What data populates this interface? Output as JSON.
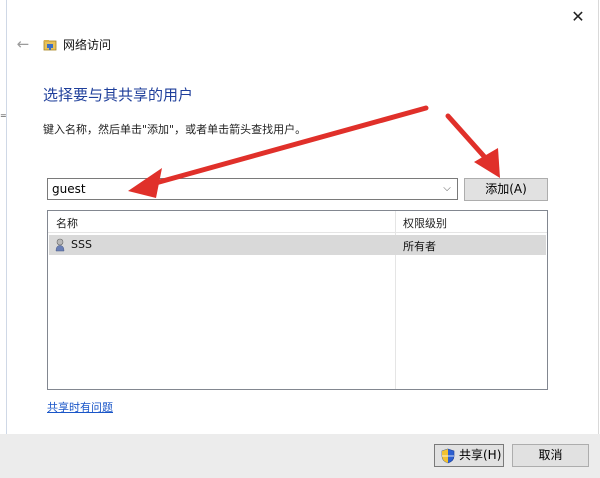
{
  "window": {
    "title": "网络访问",
    "close_glyph": "✕",
    "back_glyph": "←",
    "left_edge_glyph": "="
  },
  "main": {
    "heading": "选择要与其共享的用户",
    "hint": "键入名称，然后单击\"添加\"，或者单击箭头查找用户。"
  },
  "user_input": {
    "value": "guest",
    "dropdown_glyph": "⌵"
  },
  "add_button": {
    "label": "添加(A)"
  },
  "table": {
    "columns": [
      "名称",
      "权限级别"
    ],
    "rows": [
      {
        "name": "SSS",
        "permission": "所有者"
      }
    ]
  },
  "help_link": {
    "label": "共享时有问题"
  },
  "footer": {
    "share_label": "共享(H)",
    "cancel_label": "取消"
  },
  "colors": {
    "heading": "#1f3f9b",
    "link": "#1a56c8",
    "annotation_arrow": "#e0302a",
    "selected_row": "#d9d9d9"
  },
  "icons": {
    "title_icon": "network-share-folder-icon",
    "user_icon": "user-icon",
    "shield_icon": "uac-shield-icon"
  }
}
